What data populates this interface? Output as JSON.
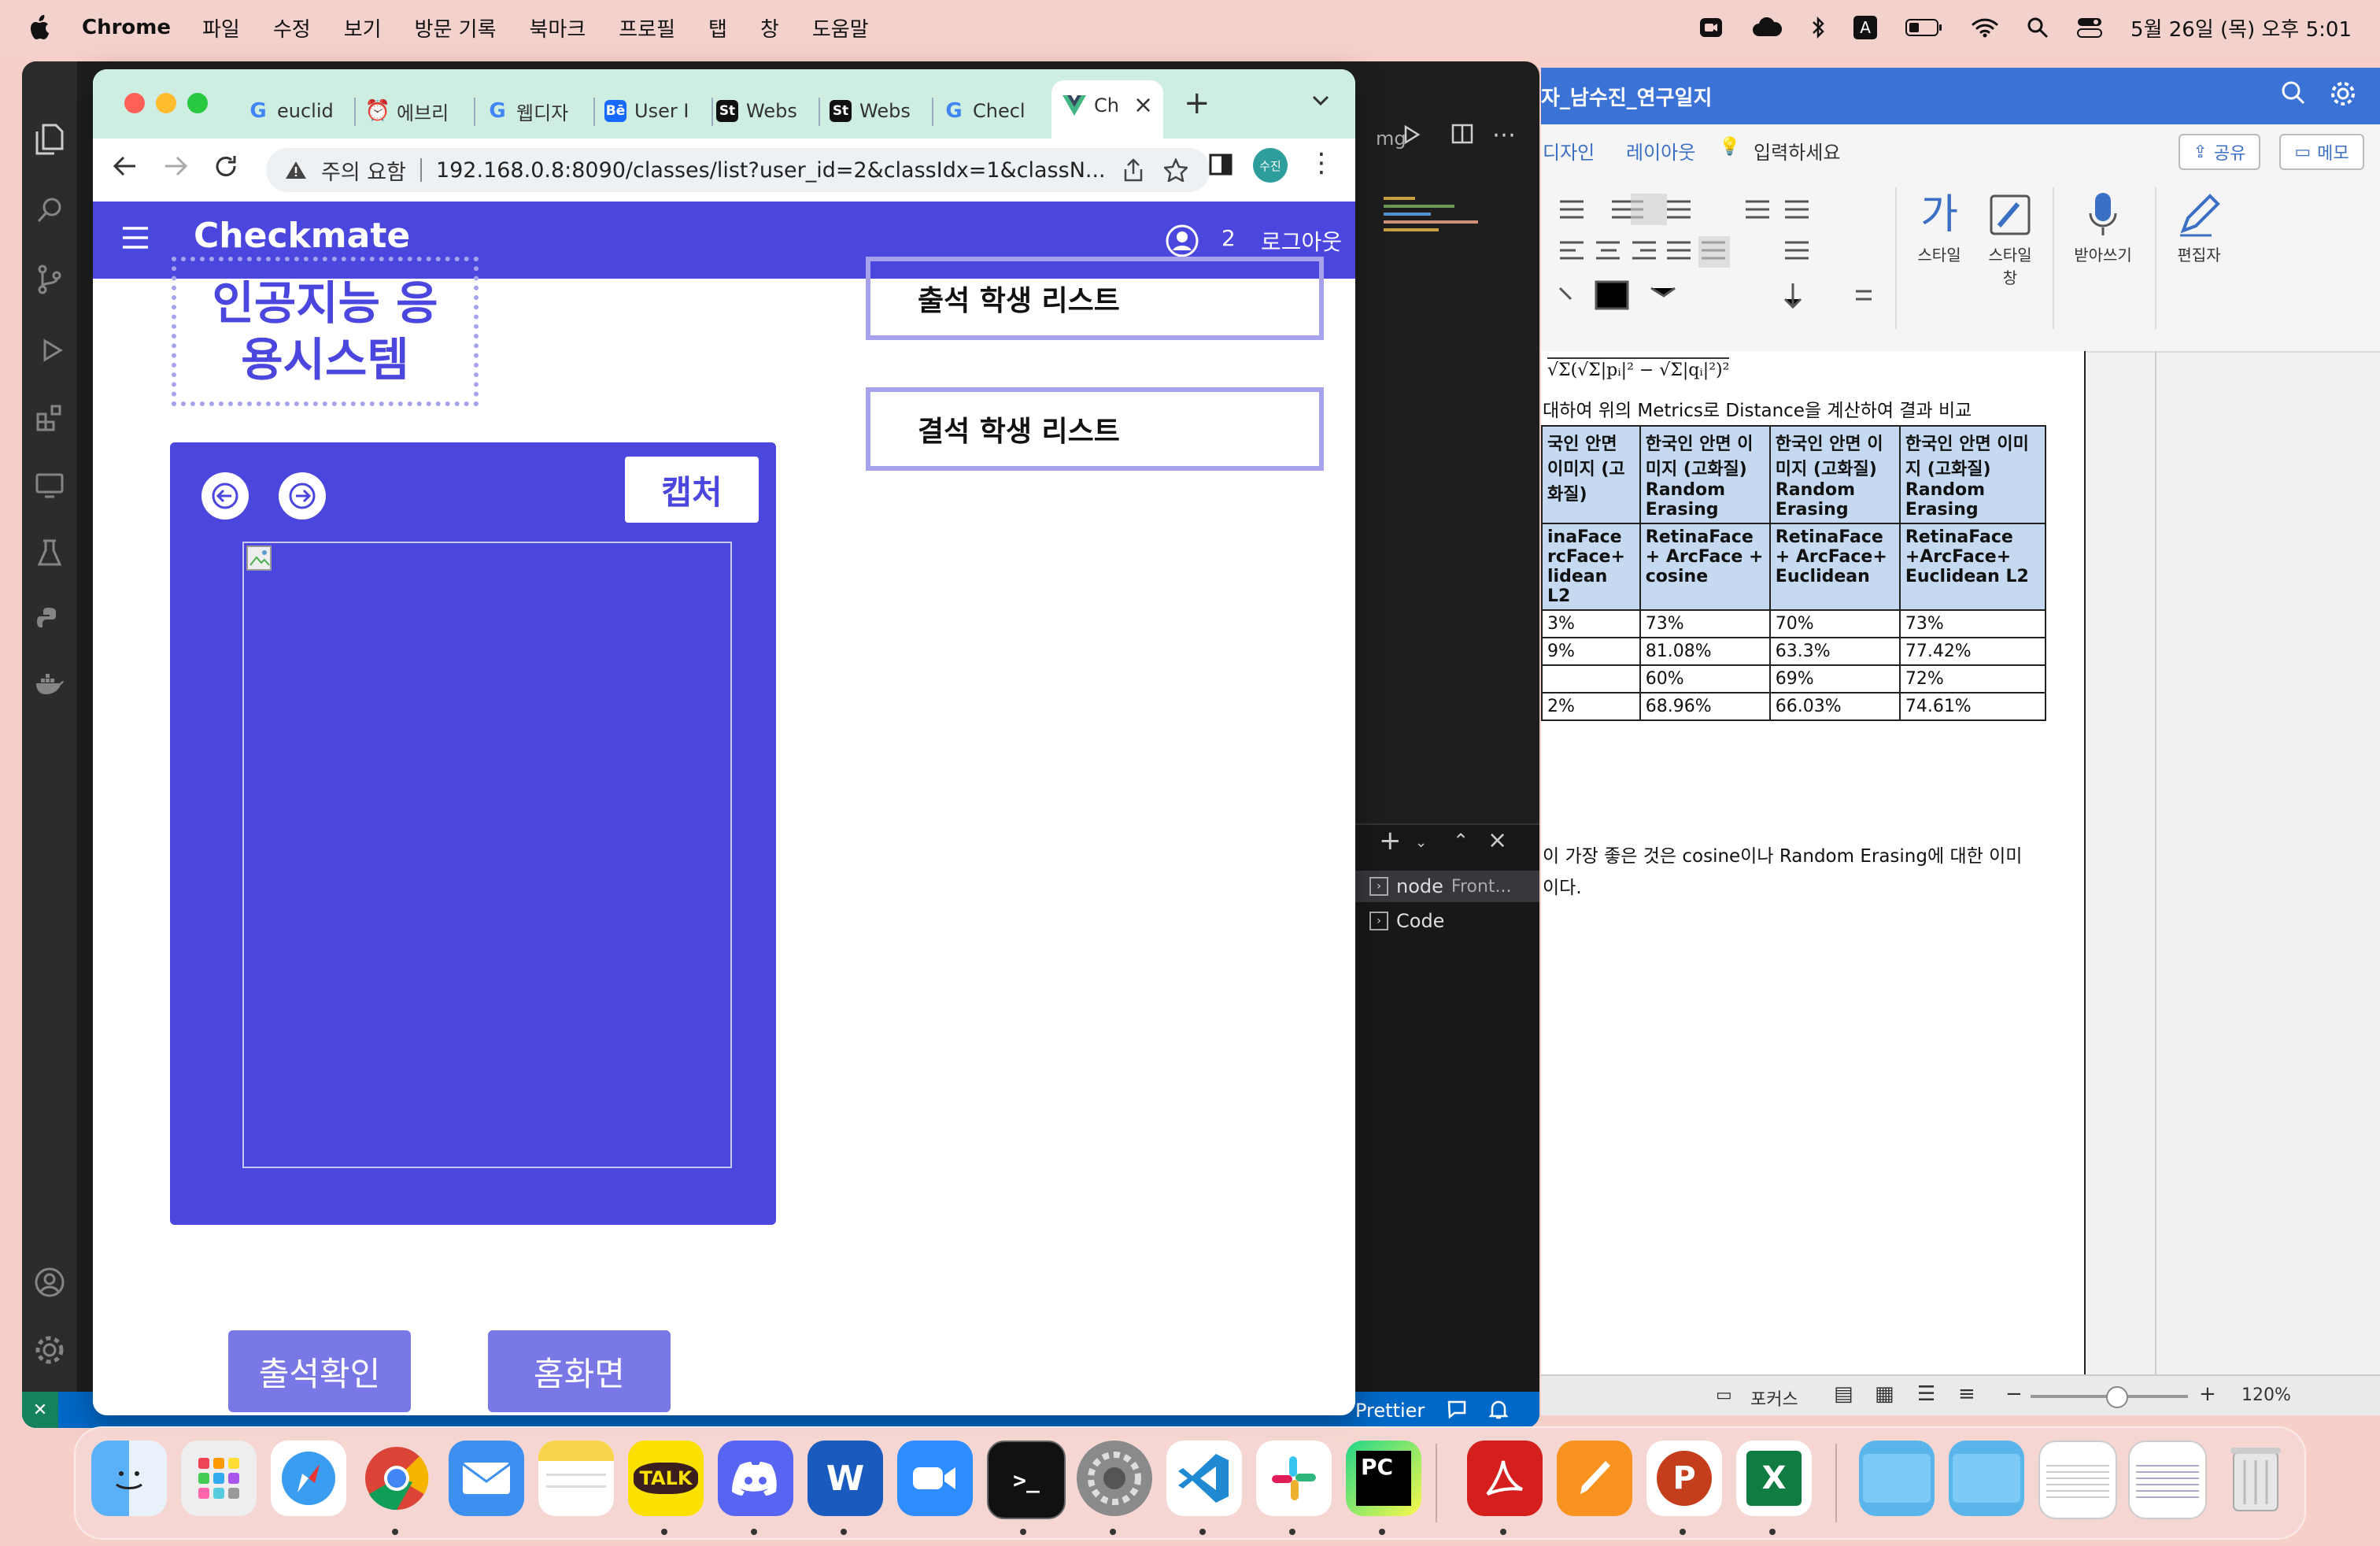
{
  "menubar": {
    "app_name": "Chrome",
    "items": [
      "파일",
      "수정",
      "보기",
      "방문 기록",
      "북마크",
      "프로필",
      "탭",
      "창",
      "도움말"
    ],
    "clock": "5월 26일 (목) 오후 5:01",
    "input_indicator": "A"
  },
  "vscode": {
    "panel_items": [
      {
        "label": "node",
        "detail": "Front..."
      },
      {
        "label": "Code",
        "detail": ""
      }
    ],
    "status_prettier": "Prettier",
    "editor_fragment": "mg"
  },
  "word": {
    "title": "자_남수진_연구일지",
    "tabs": [
      "디자인",
      "레이아웃",
      "입력하세요"
    ],
    "share": "공유",
    "memo": "메모",
    "ribbon_labels": [
      "스타일",
      "스타일 창",
      "받아쓰기",
      "편집자"
    ],
    "formula": "√Σ(√Σ|pᵢ|² − √Σ|qᵢ|²)²",
    "intro_line": "대하여 위의 Metrics로 Distance을 계산하여 결과 비교",
    "table": {
      "header": [
        "국인 안면 이미지 (고화질)",
        "한국인 안면 이미지 (고화질) Random Erasing",
        "한국인 안면 이미지 (고화질) Random Erasing",
        "한국인 안면 이미지 (고화질) Random Erasing"
      ],
      "methods": [
        "inaFace rcFace+ lidean L2",
        "RetinaFace + ArcFace + cosine",
        "RetinaFace + ArcFace+ Euclidean",
        "RetinaFace +ArcFace+ Euclidean L2"
      ],
      "rows": [
        [
          "3%",
          "73%",
          "70%",
          "73%"
        ],
        [
          "9%",
          "81.08%",
          "63.3%",
          "77.42%"
        ],
        [
          "",
          "60%",
          "69%",
          "72%"
        ],
        [
          "2%",
          "68.96%",
          "66.03%",
          "74.61%"
        ]
      ]
    },
    "conclusion_1": "이 가장 좋은 것은 cosine이나 Random Erasing에 대한 이미",
    "conclusion_2": "이다.",
    "status_focus": "포커스",
    "zoom": "120%"
  },
  "chrome": {
    "tabs": [
      {
        "icon": "google",
        "label": "euclid"
      },
      {
        "icon": "alarm",
        "label": "에브리"
      },
      {
        "icon": "google",
        "label": "웹디자"
      },
      {
        "icon": "behance",
        "label": "User I"
      },
      {
        "icon": "storybook",
        "label": "Webs"
      },
      {
        "icon": "storybook",
        "label": "Webs"
      },
      {
        "icon": "google",
        "label": "Checl"
      },
      {
        "icon": "vue",
        "label": "Ch"
      }
    ],
    "security_label": "주의 요함",
    "url": "192.168.0.8:8090/classes/list?user_id=2&classIdx=1&classN...",
    "profile_initial": "수진"
  },
  "app": {
    "brand": "Checkmate",
    "user_id": "2",
    "logout": "로그아웃",
    "class_title": "인공지능 응용시스템",
    "capture_label": "캡처",
    "present_list_label": "출석 학생 리스트",
    "absent_list_label": "결석 학생 리스트",
    "check_attendance_label": "출석확인",
    "home_label": "홈화면"
  },
  "colors": {
    "primary": "#4B46DD",
    "primary_light": "#A6A3EC",
    "button": "#7A77E6",
    "tabstrip": "#CDEEE0"
  },
  "dock": {
    "apps": [
      "Finder",
      "Launchpad",
      "Safari",
      "Chrome",
      "Mail",
      "Notes",
      "KakaoTalk",
      "Discord",
      "Word",
      "Zoom",
      "Terminal",
      "System Preferences",
      "VS Code",
      "Slack",
      "PyCharm",
      "Acrobat",
      "Pages",
      "PowerPoint",
      "Excel",
      "Folder",
      "Folder",
      "Trash"
    ],
    "kakao_label": "TALK",
    "pycharm_label": "PC"
  }
}
